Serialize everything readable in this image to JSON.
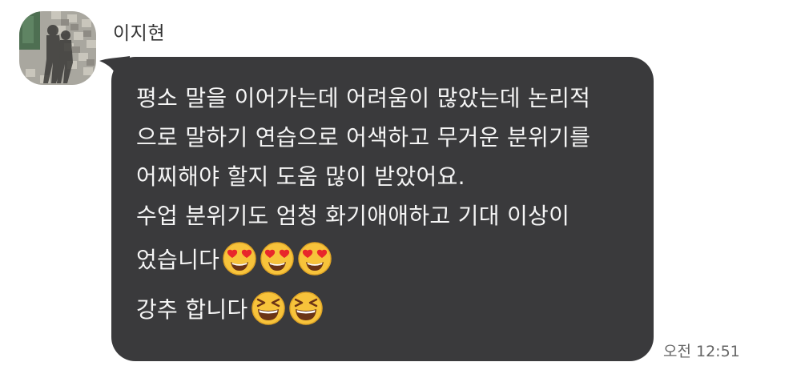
{
  "chat": {
    "sender_name": "이지현",
    "avatar_icon": "profile-photo-avatar",
    "message_lines": [
      "평소 말을 이어가는데 어려움이 많았는데 논리적",
      "으로 말하기 연습으로 어색하고 무거운 분위기를",
      "어찌해야 할지 도움 많이 받았어요.",
      "수업 분위기도 엄청 화기애애하고 기대 이상이",
      "었습니다",
      "강추 합니다"
    ],
    "emojis": {
      "line5": [
        "heart-eyes-emoji",
        "heart-eyes-emoji",
        "heart-eyes-emoji"
      ],
      "line6": [
        "grinning-squinting-emoji",
        "grinning-squinting-emoji"
      ]
    },
    "timestamp": "오전 12:51",
    "colors": {
      "bubble": "#3a3a3c",
      "text": "#f5f5f5",
      "emoji_face": "#f7c33b",
      "heart": "#e8272b"
    }
  }
}
